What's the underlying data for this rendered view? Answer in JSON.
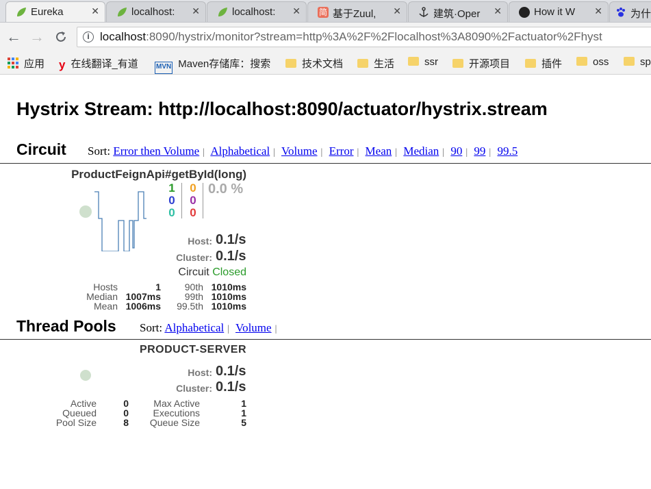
{
  "browser": {
    "tabs": [
      {
        "title": "Eureka",
        "icon": "spring-leaf-icon",
        "color": "#6db33f"
      },
      {
        "title": "localhost:",
        "icon": "spring-leaf-icon",
        "color": "#6db33f"
      },
      {
        "title": "localhost:",
        "icon": "spring-leaf-icon",
        "color": "#6db33f"
      },
      {
        "title": "基于Zuul,",
        "icon": "jianshu-icon",
        "color": "#ea6f5a"
      },
      {
        "title": "建筑·Oper",
        "icon": "anchor-icon",
        "color": "#333333"
      },
      {
        "title": "How it W",
        "icon": "github-icon",
        "color": "#222222"
      },
      {
        "title": "为什",
        "icon": "baidu-paw-icon",
        "color": "#2932e1"
      }
    ],
    "url_host": "localhost",
    "url_rest": ":8090/hystrix/monitor?stream=http%3A%2F%2Flocalhost%3A8090%2Factuator%2Fhyst",
    "bookmarks": [
      {
        "label": "应用",
        "icon": "apps-grid-icon"
      },
      {
        "label": "在线翻译_有道",
        "icon": "youdao-icon"
      },
      {
        "label": "Maven存储库：搜索",
        "icon": "maven-icon"
      },
      {
        "label": "技术文档",
        "icon": "folder-icon"
      },
      {
        "label": "生活",
        "icon": "folder-icon"
      },
      {
        "label": "ssr",
        "icon": "folder-icon"
      },
      {
        "label": "开源项目",
        "icon": "folder-icon"
      },
      {
        "label": "插件",
        "icon": "folder-icon"
      },
      {
        "label": "oss",
        "icon": "folder-icon"
      },
      {
        "label": "sp",
        "icon": "folder-icon"
      }
    ]
  },
  "page": {
    "title": "Hystrix Stream: http://localhost:8090/actuator/hystrix.stream"
  },
  "circuit": {
    "heading": "Circuit",
    "sort_label": "Sort:",
    "sort_links": [
      "Error then Volume",
      "Alphabetical",
      "Volume",
      "Error",
      "Mean",
      "Median",
      "90",
      "99",
      "99.5"
    ],
    "name": "ProductFeignApi#getById(long)",
    "counts_left": [
      "1",
      "0",
      "0"
    ],
    "counts_right": [
      "0",
      "0",
      "0"
    ],
    "count_colors_left": [
      "#2a9b2a",
      "#2d3fd1",
      "#2fbfa4"
    ],
    "count_colors_right": [
      "#f0a020",
      "#9a2fa6",
      "#e23b3b"
    ],
    "error_pct": "0.0 %",
    "host_label": "Host:",
    "host_rate": "0.1/s",
    "cluster_label": "Cluster:",
    "cluster_rate": "0.1/s",
    "circuit_label": "Circuit",
    "circuit_status": "Closed",
    "stats": {
      "hosts_label": "Hosts",
      "hosts": "1",
      "median_label": "Median",
      "median": "1007ms",
      "mean_label": "Mean",
      "mean": "1006ms",
      "p90_label": "90th",
      "p90": "1010ms",
      "p99_label": "99th",
      "p99": "1010ms",
      "p995_label": "99.5th",
      "p995": "1010ms"
    }
  },
  "thread_pools": {
    "heading": "Thread Pools",
    "sort_label": "Sort:",
    "sort_links": [
      "Alphabetical",
      "Volume"
    ],
    "name": "PRODUCT-SERVER",
    "host_label": "Host:",
    "host_rate": "0.1/s",
    "cluster_label": "Cluster:",
    "cluster_rate": "0.1/s",
    "stats": {
      "active_label": "Active",
      "active": "0",
      "queued_label": "Queued",
      "queued": "0",
      "pool_size_label": "Pool Size",
      "pool_size": "8",
      "max_active_label": "Max Active",
      "max_active": "1",
      "executions_label": "Executions",
      "executions": "1",
      "queue_size_label": "Queue Size",
      "queue_size": "5"
    }
  }
}
